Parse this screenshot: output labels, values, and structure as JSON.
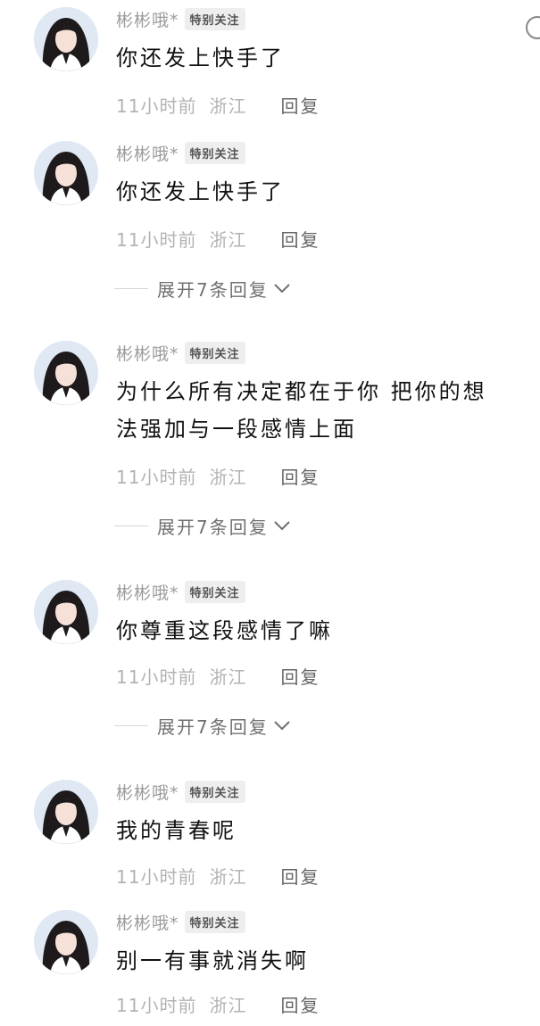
{
  "colors": {
    "username": "#9b9b9b",
    "badge_bg": "#eeeeee",
    "meta": "#b3b3b3",
    "reply": "#666666",
    "text": "#111111"
  },
  "comments": [
    {
      "username": "彬彬哦*",
      "badge": "特别关注",
      "lines": [
        "你还发上快手了"
      ],
      "time": "11小时前",
      "location": "浙江",
      "reply": "回复",
      "expand": ""
    },
    {
      "username": "彬彬哦*",
      "badge": "特别关注",
      "lines": [
        "你还发上快手了"
      ],
      "time": "11小时前",
      "location": "浙江",
      "reply": "回复",
      "expand": "展开7条回复"
    },
    {
      "username": "彬彬哦*",
      "badge": "特别关注",
      "lines": [
        "为什么所有决定都在于你 把你的想",
        "法强加与一段感情上面"
      ],
      "time": "11小时前",
      "location": "浙江",
      "reply": "回复",
      "expand": "展开7条回复"
    },
    {
      "username": "彬彬哦*",
      "badge": "特别关注",
      "lines": [
        "你尊重这段感情了嘛"
      ],
      "time": "11小时前",
      "location": "浙江",
      "reply": "回复",
      "expand": "展开7条回复"
    },
    {
      "username": "彬彬哦*",
      "badge": "特别关注",
      "lines": [
        "我的青春呢"
      ],
      "time": "11小时前",
      "location": "浙江",
      "reply": "回复",
      "expand": ""
    },
    {
      "username": "彬彬哦*",
      "badge": "特别关注",
      "lines": [
        "别一有事就消失啊"
      ],
      "time": "11小时前",
      "location": "浙江",
      "reply": "回复",
      "expand": ""
    }
  ]
}
